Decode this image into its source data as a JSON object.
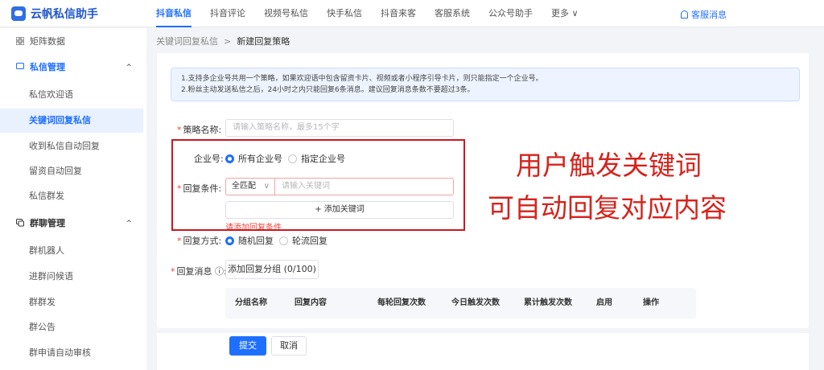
{
  "app": {
    "title": "云帆私信助手"
  },
  "nav": {
    "items": [
      "抖音私信",
      "抖音评论",
      "视频号私信",
      "快手私信",
      "抖音来客",
      "客服系统",
      "公众号助手",
      "更多"
    ],
    "more_caret": "∨",
    "customer_service": "客服消息"
  },
  "sidebar": {
    "matrix": "矩阵数据",
    "dm_group": "私信管理",
    "dm_items": [
      "私信欢迎语",
      "关键词回复私信",
      "收到私信自动回复",
      "留资自动回复",
      "私信群发"
    ],
    "group_group": "群聊管理",
    "group_items": [
      "群机器人",
      "进群问候语",
      "群群发",
      "群公告",
      "群申请自动审核"
    ],
    "caret_up": "^"
  },
  "breadcrumb": {
    "parent": "关键词回复私信",
    "sep": ">",
    "current": "新建回复策略"
  },
  "notice": {
    "line1": "1.支持多企业号共用一个策略，如果欢迎语中包含留资卡片、视频或者小程序引导卡片，则只能指定一个企业号。",
    "line2": "2.粉丝主动发送私信之后，24小时之内只能回复6条消息。建议回复消息条数不要超过3条。"
  },
  "form": {
    "name_label": "策略名称:",
    "name_placeholder": "请输入策略名称，最多15个字",
    "account_label": "企业号:",
    "account_all": "所有企业号",
    "account_specific": "指定企业号",
    "cond_label": "回复条件:",
    "match_value": "全匹配",
    "match_chev": "∨",
    "keyword_placeholder": "请输入关键词",
    "add_keyword": "+ 添加关键词",
    "cond_error": "请添加回复条件",
    "mode_label": "回复方式:",
    "mode_random": "随机回复",
    "mode_round": "轮流回复",
    "msg_label": "回复消息 ⓘ:",
    "add_group": "添加回复分组 (0/100)"
  },
  "table": {
    "headers": [
      "分组名称",
      "回复内容",
      "每轮回复次数",
      "今日触发次数",
      "累计触发次数",
      "启用",
      "操作"
    ]
  },
  "footer": {
    "submit": "提交",
    "cancel": "取消"
  },
  "overlay": {
    "line1": "用户触发关键词",
    "line2": "可自动回复对应内容"
  },
  "colors": {
    "primary": "#1e6fff",
    "annotation": "#d5231c",
    "error": "#f04438"
  }
}
